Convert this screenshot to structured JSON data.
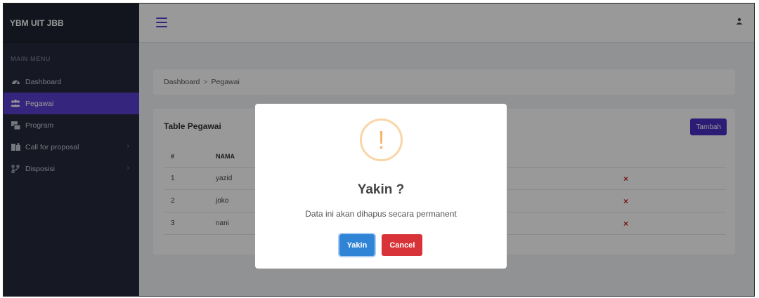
{
  "sidebar": {
    "brand": "YBM UIT JBB",
    "menu_title": "MAIN MENU",
    "items": [
      {
        "label": "Dashboard",
        "icon": "dashboard-icon",
        "active": false
      },
      {
        "label": "Pegawai",
        "icon": "users-icon",
        "active": true
      },
      {
        "label": "Program",
        "icon": "program-icon",
        "active": false
      },
      {
        "label": "Call for proposal",
        "icon": "proposal-icon",
        "active": false,
        "submenu": true
      },
      {
        "label": "Disposisi",
        "icon": "disposisi-icon",
        "active": false,
        "submenu": true
      }
    ]
  },
  "topbar": {
    "menu_icon": "hamburger-icon",
    "user_icon": "user-icon"
  },
  "breadcrumb": {
    "items": [
      "Dashboard",
      "Pegawai"
    ],
    "separator": ">"
  },
  "card": {
    "title": "Table Pegawai",
    "add_button": "Tambah",
    "columns": [
      "#",
      "NAMA"
    ],
    "rows": [
      {
        "no": "1",
        "name": "yazid",
        "action": "×"
      },
      {
        "no": "2",
        "name": "joko",
        "action": "×"
      },
      {
        "no": "3",
        "name": "nani",
        "action": "×"
      }
    ]
  },
  "modal": {
    "icon_glyph": "!",
    "title": "Yakin ?",
    "text": "Data ini akan dihapus secara permanent",
    "confirm_label": "Yakin",
    "cancel_label": "Cancel"
  },
  "colors": {
    "sidebar_bg": "#252a3c",
    "accent": "#5b3fcf",
    "confirm": "#2f84d6",
    "cancel": "#d9333a",
    "warning": "#f5b46e"
  }
}
